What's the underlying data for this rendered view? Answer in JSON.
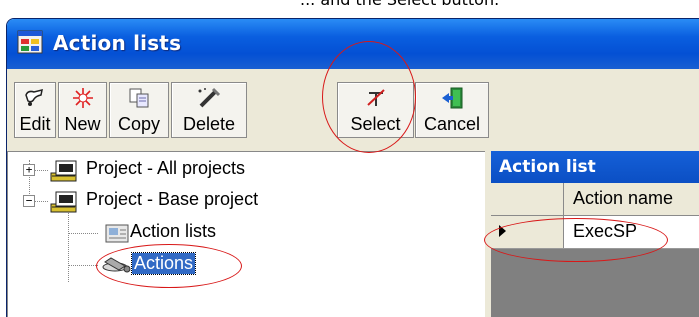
{
  "caption": "... and the Select button.",
  "window": {
    "title": "Action lists"
  },
  "toolbar": {
    "buttons": [
      {
        "label": "Edit",
        "icon": "edit-icon"
      },
      {
        "label": "New",
        "icon": "new-icon"
      },
      {
        "label": "Copy",
        "icon": "copy-icon"
      },
      {
        "label": "Delete",
        "icon": "delete-icon"
      },
      {
        "label": "Select",
        "icon": "select-icon"
      },
      {
        "label": "Cancel",
        "icon": "cancel-icon"
      }
    ]
  },
  "tree": {
    "nodes": [
      {
        "label": "Project - All projects",
        "toggle": "+"
      },
      {
        "label": "Project - Base project",
        "toggle": "−"
      },
      {
        "label": "Action lists"
      },
      {
        "label": "Actions"
      }
    ]
  },
  "panel": {
    "title": "Action list",
    "column": "Action name",
    "rows": [
      "ExecSP"
    ]
  },
  "colors": {
    "titlebar": "#0450d4",
    "highlight": "#316ac5",
    "annotation": "#d81818"
  }
}
